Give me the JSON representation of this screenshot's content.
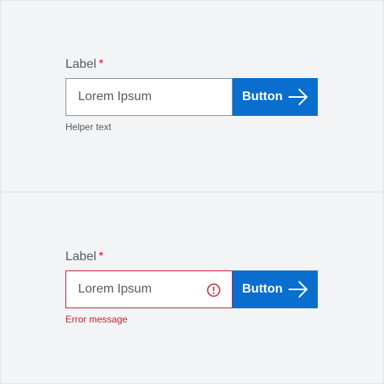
{
  "normal_field": {
    "label": "Label",
    "required_marker": "*",
    "input_value": "Lorem Ipsum",
    "button_label": "Button",
    "helper_text": "Helper text"
  },
  "error_field": {
    "label": "Label",
    "required_marker": "*",
    "input_value": "Lorem Ipsum",
    "button_label": "Button",
    "error_message": "Error message"
  },
  "icons": {
    "button_icon": "arrow-right-icon",
    "error_icon": "exclamation-circle-icon"
  },
  "colors": {
    "background": "#f3f4f6",
    "button": "#0a6ecf",
    "error": "#c8222c",
    "text": "#555a60"
  }
}
